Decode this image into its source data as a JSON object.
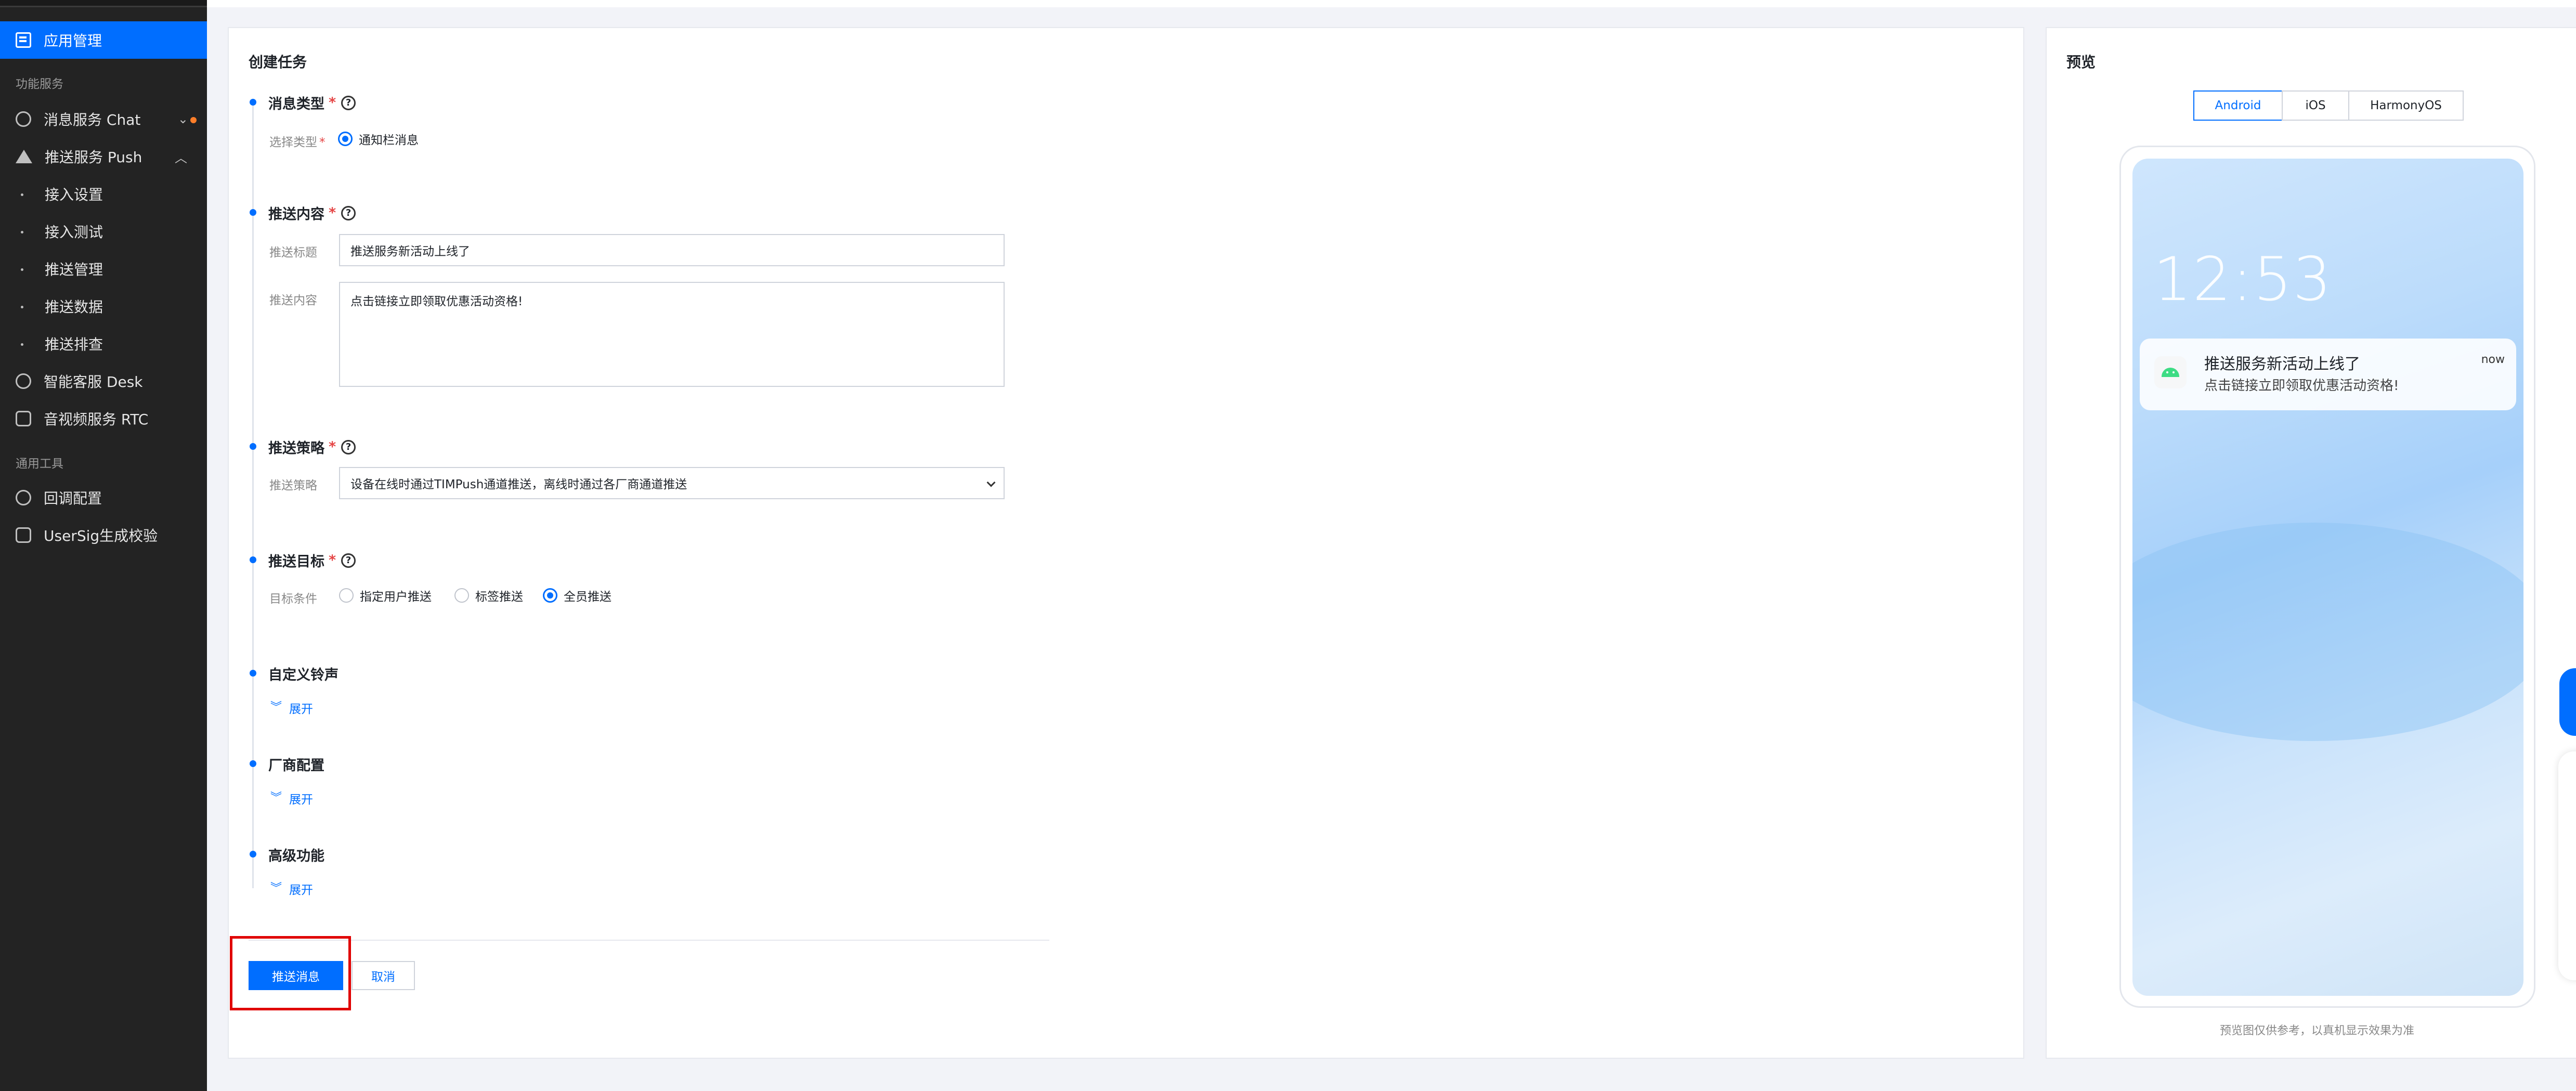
{
  "sidebar": {
    "active_item": "应用管理",
    "section_features": "功能服务",
    "chat": "消息服务 Chat",
    "push": "推送服务 Push",
    "push_sub": [
      "接入设置",
      "接入测试",
      "推送管理",
      "推送数据",
      "推送排查"
    ],
    "desk": "智能客服 Desk",
    "rtc": "音视频服务 RTC",
    "section_tools": "通用工具",
    "callback": "回调配置",
    "usersig": "UserSig生成校验"
  },
  "form": {
    "title": "创建任务",
    "msg_type": {
      "title": "消息类型",
      "label": "选择类型",
      "option": "通知栏消息"
    },
    "content": {
      "title": "推送内容",
      "title_label": "推送标题",
      "title_value": "推送服务新活动上线了",
      "body_label": "推送内容",
      "body_value": "点击链接立即领取优惠活动资格!"
    },
    "strategy": {
      "title": "推送策略",
      "label": "推送策略",
      "value": "设备在线时通过TIMPush通道推送，离线时通过各厂商通道推送"
    },
    "target": {
      "title": "推送目标",
      "label": "目标条件",
      "options": [
        "指定用户推送",
        "标签推送",
        "全员推送"
      ],
      "selected": "全员推送"
    },
    "ringtone": {
      "title": "自定义铃声",
      "expand": "展开"
    },
    "vendor": {
      "title": "厂商配置",
      "expand": "展开"
    },
    "advanced": {
      "title": "高级功能",
      "expand": "展开"
    },
    "submit": "推送消息",
    "cancel": "取消"
  },
  "preview": {
    "title": "预览",
    "tabs": [
      "Android",
      "iOS",
      "HarmonyOS"
    ],
    "active_tab": "Android",
    "clock": "12:53",
    "notification": {
      "title": "推送服务新活动上线了",
      "body": "点击链接立即领取优惠活动资格!",
      "time": "now"
    },
    "footnote": "预览图仅供参考，以真机显示效果为准"
  },
  "colors": {
    "accent": "#006eff",
    "sidebar_bg": "#232323",
    "required": "#e54545",
    "highlight_box": "#e00000"
  }
}
